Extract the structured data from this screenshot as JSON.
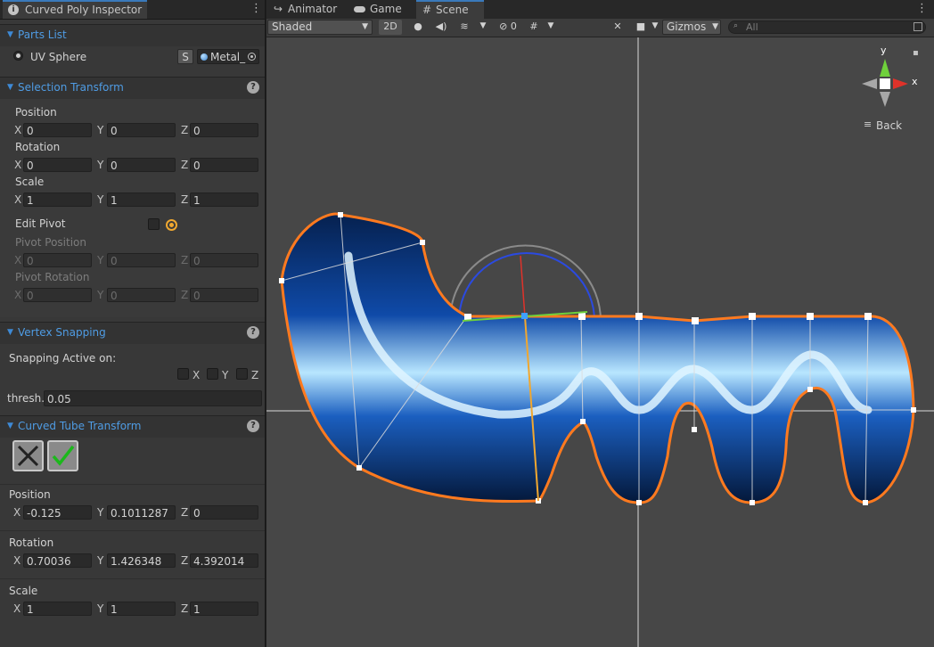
{
  "inspector": {
    "tab_title": "Curved Poly Inspector",
    "parts_list": {
      "title": "Parts List",
      "item_label": "UV Sphere",
      "s_button": "S",
      "material": "Metal_"
    },
    "selection_transform": {
      "title": "Selection Transform",
      "position_label": "Position",
      "rotation_label": "Rotation",
      "scale_label": "Scale",
      "position": {
        "x": "0",
        "y": "0",
        "z": "0"
      },
      "rotation": {
        "x": "0",
        "y": "0",
        "z": "0"
      },
      "scale": {
        "x": "1",
        "y": "1",
        "z": "1"
      },
      "edit_pivot_label": "Edit Pivot",
      "pivot_position_label": "Pivot Position",
      "pivot_rotation_label": "Pivot Rotation",
      "pivot_position": {
        "x": "0",
        "y": "0",
        "z": "0"
      },
      "pivot_rotation": {
        "x": "0",
        "y": "0",
        "z": "0"
      }
    },
    "vertex_snapping": {
      "title": "Vertex Snapping",
      "active_label": "Snapping Active on:",
      "x_label": "X",
      "y_label": "Y",
      "z_label": "Z",
      "thresh_label": "thresh.",
      "thresh_value": "0.05"
    },
    "curved_tube_transform": {
      "title": "Curved Tube Transform",
      "position_label": "Position",
      "rotation_label": "Rotation",
      "scale_label": "Scale",
      "position": {
        "x": "-0.125",
        "y": "0.1011287",
        "z": "0"
      },
      "rotation": {
        "x": "0.70036",
        "y": "1.426348",
        "z": "4.392014"
      },
      "scale": {
        "x": "1",
        "y": "1",
        "z": "1"
      }
    },
    "axis_labels": {
      "x": "X",
      "y": "Y",
      "z": "Z"
    }
  },
  "tabs": [
    {
      "label": "Animator",
      "icon": "animator-icon"
    },
    {
      "label": "Game",
      "icon": "gamepad-icon"
    },
    {
      "label": "Scene",
      "icon": "scene-grid-icon",
      "active": true
    }
  ],
  "scene_toolbar": {
    "shading_mode": "Shaded",
    "mode_2d": "2D",
    "hidden_count": "0",
    "gizmos_label": "Gizmos",
    "search_placeholder": "All"
  },
  "orientation_gizmo": {
    "y_label": "y",
    "x_label": "x",
    "back_label": "Back"
  },
  "colors": {
    "accent_blue": "#4f9ce4",
    "outline_orange": "#ff7a1f",
    "gizmo_x": "#e0322a",
    "gizmo_y": "#6fd13b"
  }
}
